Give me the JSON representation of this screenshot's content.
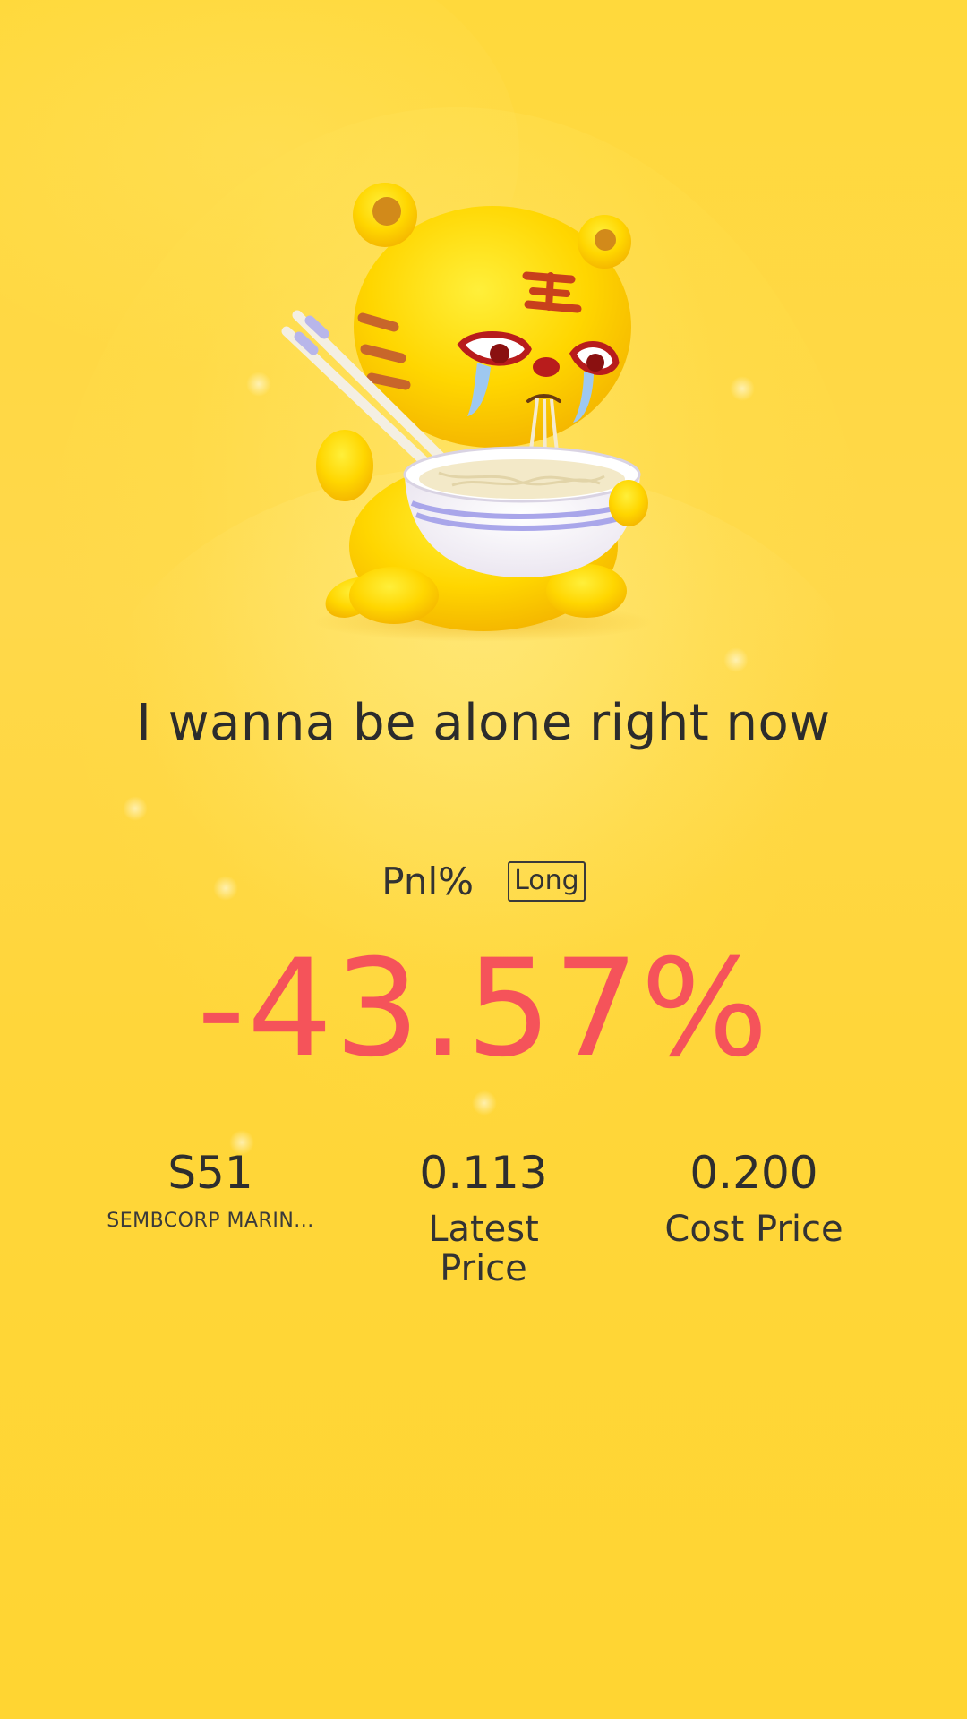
{
  "headline": "I wanna be alone right now",
  "pnl": {
    "label": "Pnl%",
    "side": "Long",
    "value": "-43.57%"
  },
  "stats": {
    "symbol": "S51",
    "symbol_name": "SEMBCORP MARIN...",
    "latest_price": "0.113",
    "latest_price_label": "Latest Price",
    "cost_price": "0.200",
    "cost_price_label": "Cost Price"
  },
  "colors": {
    "background": "#ffd93c",
    "loss": "#f5535a",
    "text": "#2e2e2e"
  },
  "mascot": {
    "icon": "crying-tiger-eating-noodles-icon"
  }
}
